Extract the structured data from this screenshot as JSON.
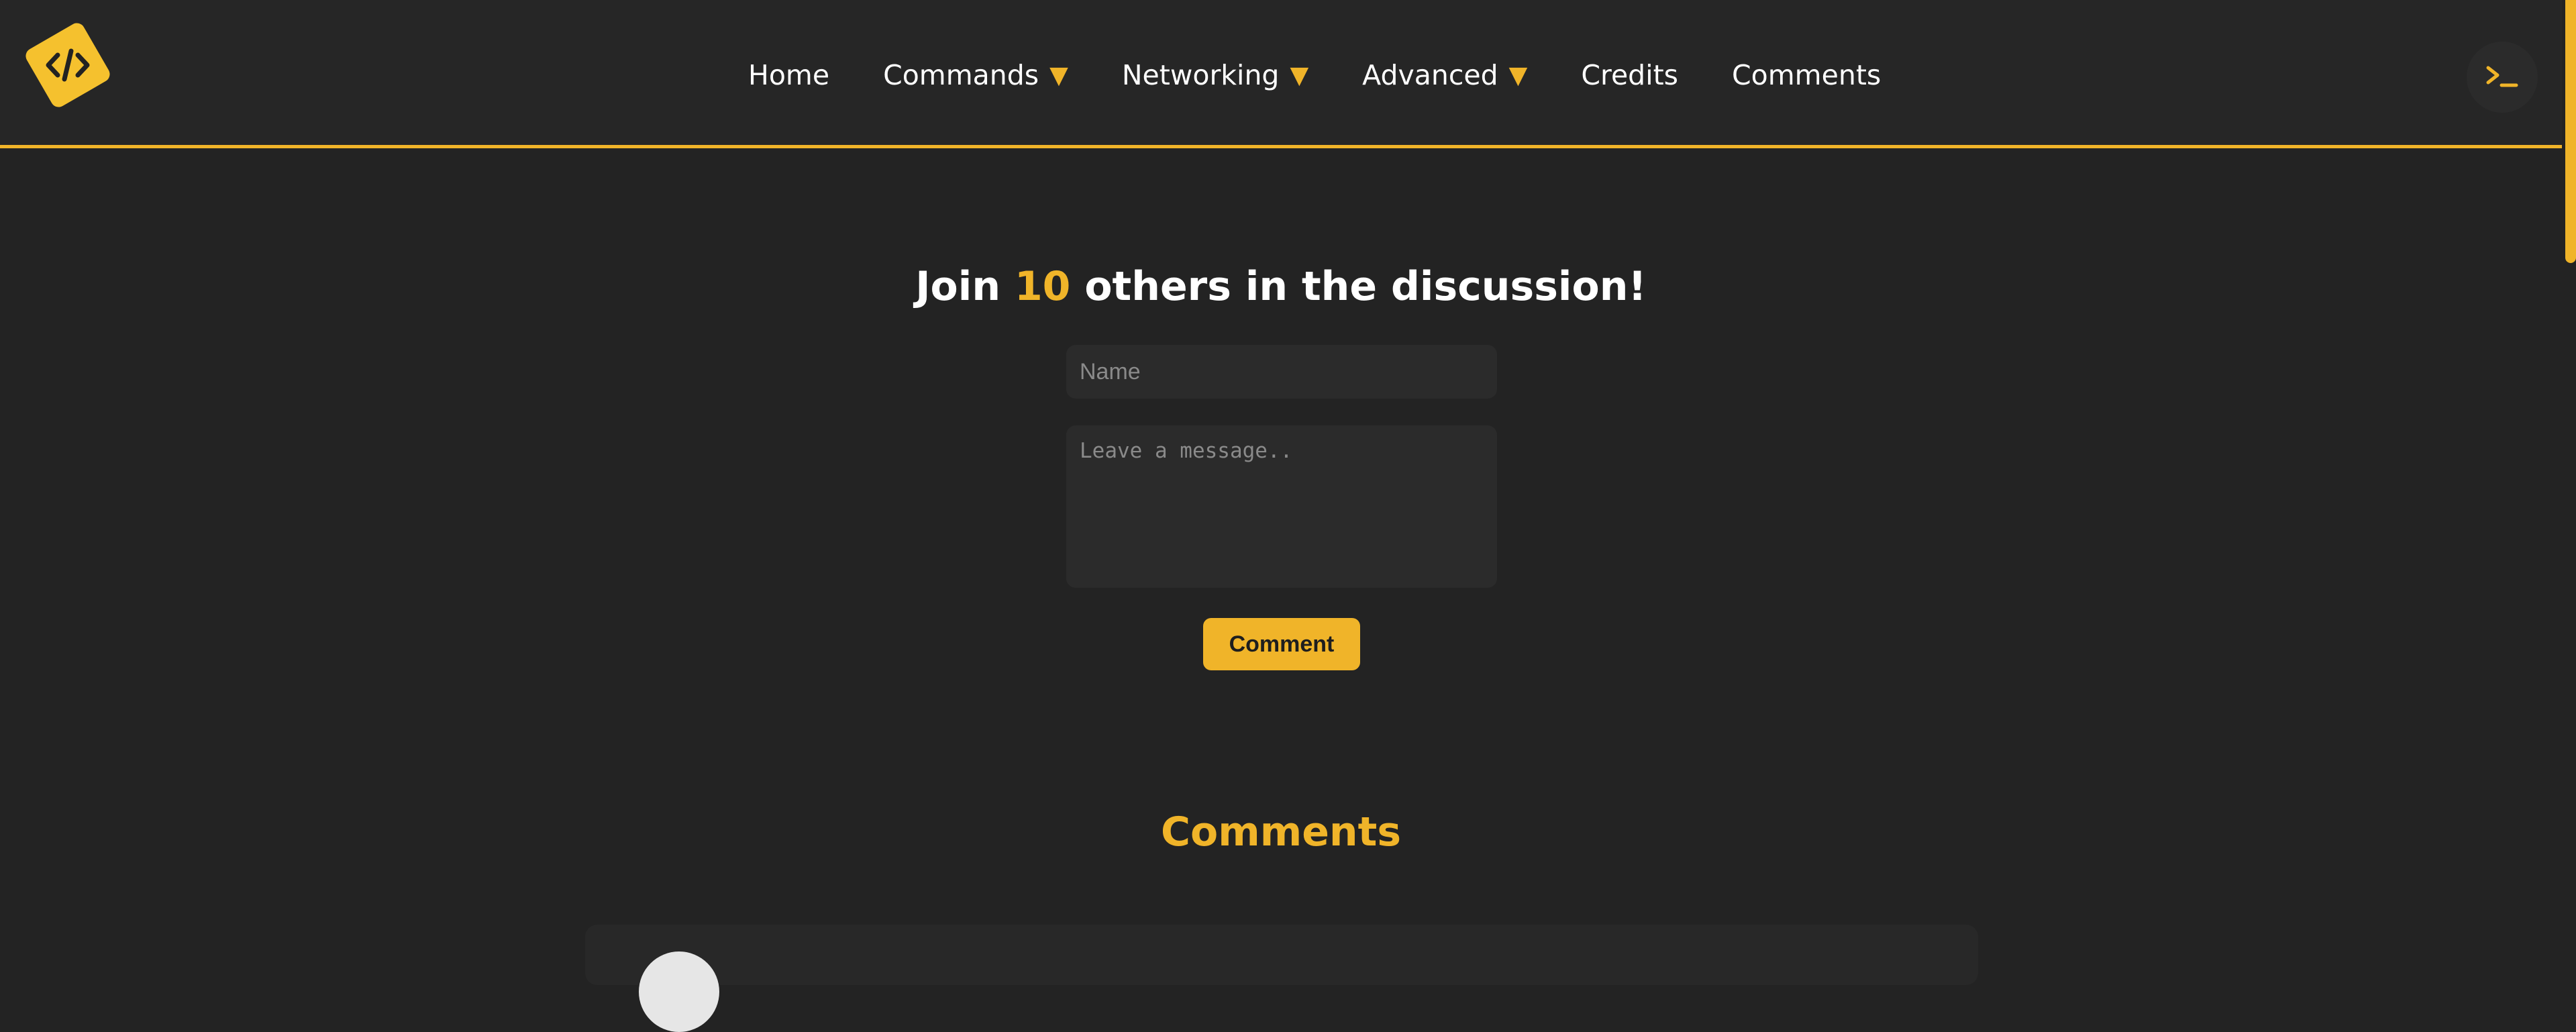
{
  "nav": {
    "items": [
      {
        "label": "Home",
        "dropdown": false
      },
      {
        "label": "Commands",
        "dropdown": true
      },
      {
        "label": "Networking",
        "dropdown": true
      },
      {
        "label": "Advanced",
        "dropdown": true
      },
      {
        "label": "Credits",
        "dropdown": false
      },
      {
        "label": "Comments",
        "dropdown": false
      }
    ],
    "caret": "▼",
    "logo_icon": "code-brackets-icon",
    "terminal_icon": "terminal-icon"
  },
  "form": {
    "heading_prefix": "Join",
    "count": "10",
    "heading_suffix": "others in the discussion!",
    "name_placeholder": "Name",
    "message_placeholder": "Leave a message..",
    "submit_label": "Comment"
  },
  "comments": {
    "heading": "Comments"
  },
  "colors": {
    "accent": "#f0b429",
    "background": "#232323",
    "header": "#262626",
    "input": "#2b2b2b"
  }
}
